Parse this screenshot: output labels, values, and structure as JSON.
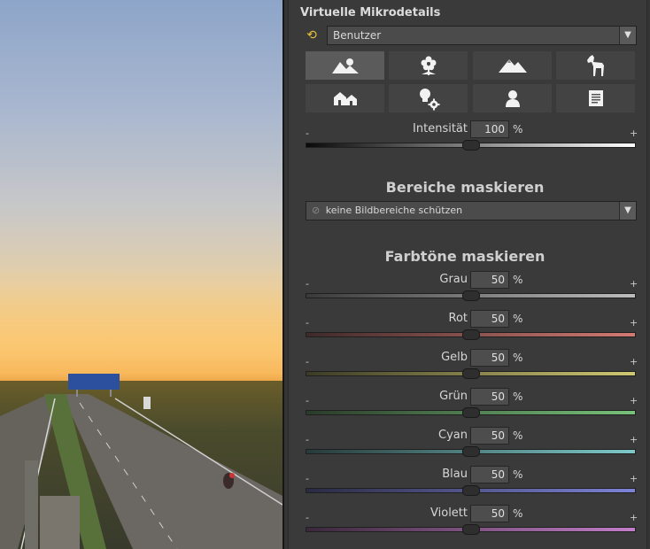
{
  "panel": {
    "title": "Virtuelle Mikrodetails",
    "preset": {
      "value": "Benutzer",
      "icon": "refresh-icon"
    },
    "preset_icons": [
      {
        "name": "landscape-icon",
        "active": true
      },
      {
        "name": "flower-icon",
        "active": false
      },
      {
        "name": "mountain-icon",
        "active": false
      },
      {
        "name": "horse-icon",
        "active": false
      },
      {
        "name": "houses-icon",
        "active": false
      },
      {
        "name": "bulb-gear-icon",
        "active": false
      },
      {
        "name": "portrait-icon",
        "active": false
      },
      {
        "name": "document-icon",
        "active": false
      }
    ],
    "intensity": {
      "label": "Intensität",
      "value": "100",
      "unit": "%",
      "level": 1.0,
      "minus": "-",
      "plus": "+"
    }
  },
  "mask_areas": {
    "title": "Bereiche maskieren",
    "dropdown_value": "keine Bildbereiche schützen",
    "icon": "no-entry-icon"
  },
  "mask_tones": {
    "title": "Farbtöne maskieren",
    "sliders": [
      {
        "label": "Grau",
        "value": "50",
        "unit": "%",
        "minus": "-",
        "plus": "+",
        "colors": [
          "#3a3a3a",
          "#bdbdbd"
        ]
      },
      {
        "label": "Rot",
        "value": "50",
        "unit": "%",
        "minus": "-",
        "plus": "+",
        "colors": [
          "#3e2a2a",
          "#d37a72"
        ]
      },
      {
        "label": "Gelb",
        "value": "50",
        "unit": "%",
        "minus": "-",
        "plus": "+",
        "colors": [
          "#3b3a26",
          "#cfc872"
        ]
      },
      {
        "label": "Grün",
        "value": "50",
        "unit": "%",
        "minus": "-",
        "plus": "+",
        "colors": [
          "#2a3a2a",
          "#78c27a"
        ]
      },
      {
        "label": "Cyan",
        "value": "50",
        "unit": "%",
        "minus": "-",
        "plus": "+",
        "colors": [
          "#273a3a",
          "#7ec9c9"
        ]
      },
      {
        "label": "Blau",
        "value": "50",
        "unit": "%",
        "minus": "-",
        "plus": "+",
        "colors": [
          "#2a2a42",
          "#7d83d6"
        ]
      },
      {
        "label": "Violett",
        "value": "50",
        "unit": "%",
        "minus": "-",
        "plus": "+",
        "colors": [
          "#3a283a",
          "#c37ec9"
        ]
      }
    ]
  }
}
